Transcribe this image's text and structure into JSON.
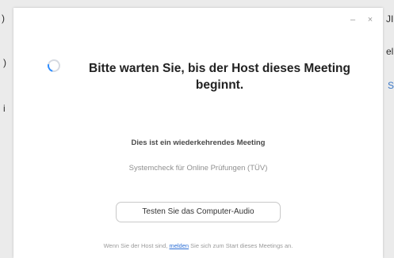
{
  "window_controls": {
    "minimize_label": "–",
    "close_label": "×"
  },
  "background_fragments": {
    "left_1": ")",
    "left_2": ")",
    "left_3": "i",
    "right_1": "JI",
    "right_2": "el",
    "right_3": "S"
  },
  "dialog": {
    "title": "Bitte warten Sie, bis der Host dieses Meeting beginnt.",
    "recurring_text": "Dies ist ein wiederkehrendes Meeting",
    "meeting_name": "Systemcheck für Online Prüfungen (TÜV)",
    "audio_button_label": "Testen Sie das Computer-Audio",
    "footer_prefix": "Wenn Sie der Host sind,",
    "footer_link": "melden",
    "footer_suffix": "Sie sich zum Start dieses Meetings an."
  },
  "colors": {
    "accent": "#2d8cff",
    "link": "#2d6fd6"
  }
}
